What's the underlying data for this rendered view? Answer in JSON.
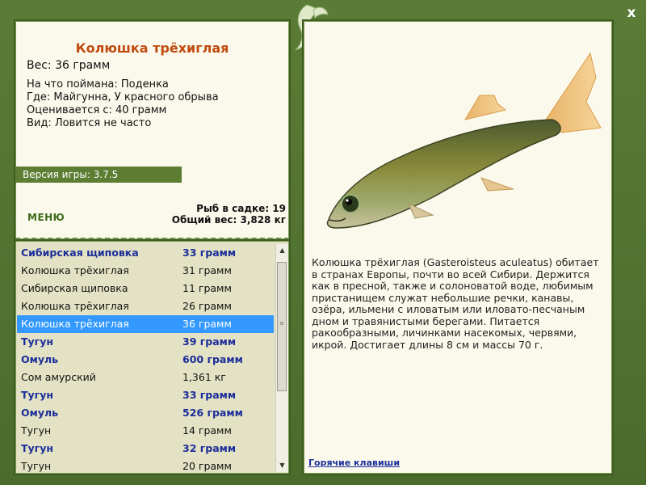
{
  "window": {
    "close_label": "x"
  },
  "fish": {
    "title": "Колюшка трёхиглая",
    "weight": "Вес: 36 грамм",
    "caught_on": "На что поймана: Поденка",
    "where": "Где: Майгунна, У красного обрыва",
    "value": "Оценивается с: 40 грамм",
    "rarity": "Вид: Ловится не часто",
    "description": "Колюшка трёхиглая (Gasteroisteus aculeatus) обитает в странах Европы, почти во всей Сибири. Держится как в пресной, также и солоноватой воде, любимым пристанищем служат небольшие речки, канавы, озёра, ильмени с иловатым или иловато-песчаным дном и травянистыми берегами. Питается ракообразными, личинками насекомых, червями, икрой. Достигает длины 8 см и массы 70 г."
  },
  "version": "Версия игры: 3.7.5",
  "menu_label": "МЕНЮ",
  "stats": {
    "fish_count": "Рыб в садке: 19",
    "total_weight": "Общий вес: 3,828 кг"
  },
  "catch_list": [
    {
      "name": "Сибирская щиповка",
      "weight": "33 грамм",
      "bold": true
    },
    {
      "name": "Колюшка трёхиглая",
      "weight": "31 грамм",
      "bold": false
    },
    {
      "name": "Сибирская щиповка",
      "weight": "11 грамм",
      "bold": false
    },
    {
      "name": "Колюшка трёхиглая",
      "weight": "26 грамм",
      "bold": false
    },
    {
      "name": "Колюшка трёхиглая",
      "weight": "36 грамм",
      "bold": false,
      "selected": true
    },
    {
      "name": "Тугун",
      "weight": "39 грамм",
      "bold": true
    },
    {
      "name": "Омуль",
      "weight": "600 грамм",
      "bold": true
    },
    {
      "name": "Сом амурский",
      "weight": "1,361 кг",
      "bold": false
    },
    {
      "name": "Тугун",
      "weight": "33 грамм",
      "bold": true
    },
    {
      "name": "Омуль",
      "weight": "526 грамм",
      "bold": true
    },
    {
      "name": "Тугун",
      "weight": "14 грамм",
      "bold": false
    },
    {
      "name": "Тугун",
      "weight": "32 грамм",
      "bold": true
    },
    {
      "name": "Тугун",
      "weight": "20 грамм",
      "bold": false
    }
  ],
  "hotkeys_label": "Горячие клавиши",
  "colors": {
    "frame": "#4e6f2f",
    "panel": "#fbf9ec",
    "title": "#c04a10",
    "selected": "#3399ff",
    "bold_row": "#1b2e9a"
  },
  "icons": {
    "logo": "leaf-logo-icon",
    "close": "close-icon",
    "scroll_up": "arrow-up-icon",
    "scroll_down": "arrow-down-icon"
  }
}
